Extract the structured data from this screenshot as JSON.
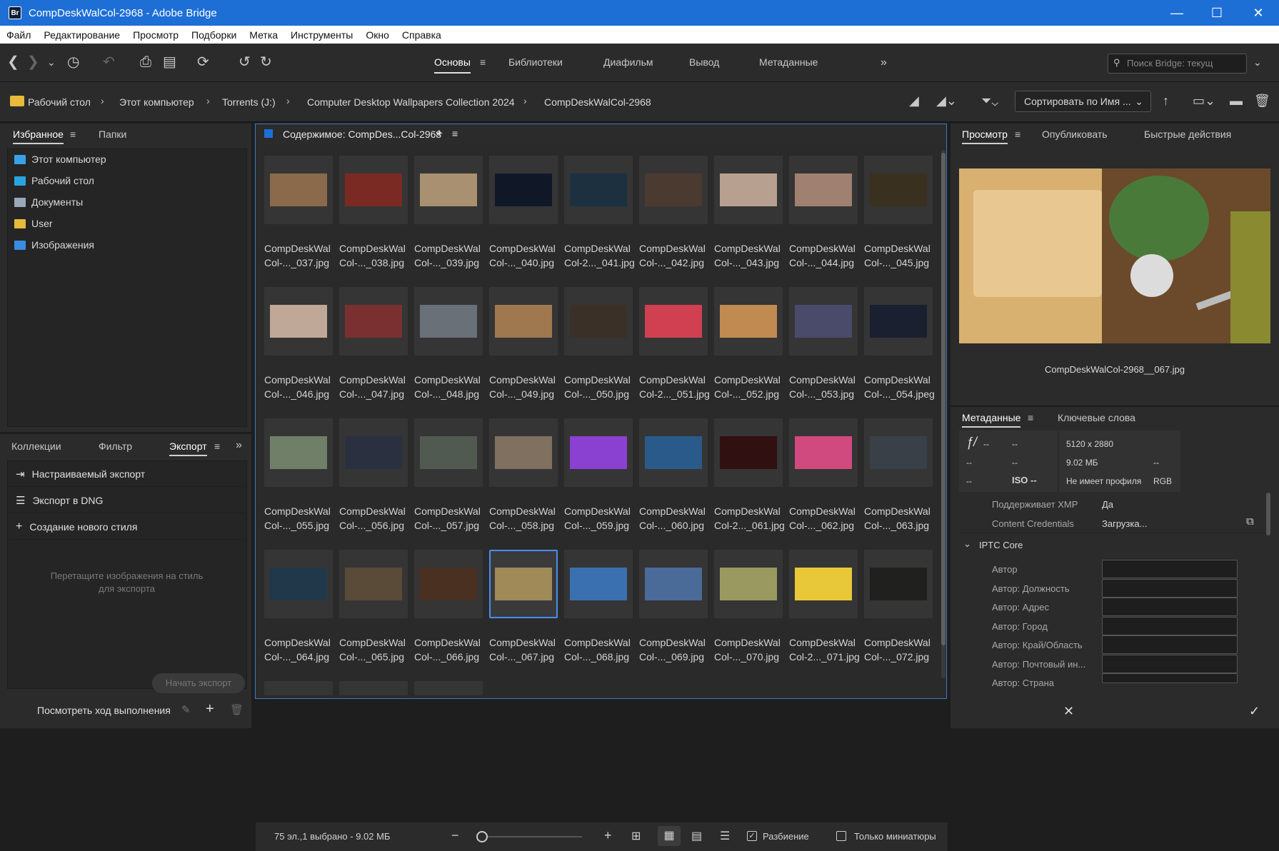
{
  "window": {
    "logo": "Br",
    "title": "CompDeskWalCol-2968 - Adobe Bridge",
    "minimize_icon": "—",
    "maximize_icon": "☐",
    "close_icon": "✕"
  },
  "menu": [
    "Файл",
    "Редактирование",
    "Просмотр",
    "Подборки",
    "Метка",
    "Инструменты",
    "Окно",
    "Справка"
  ],
  "workspaces": [
    "Основы",
    "Библиотеки",
    "Диафильм",
    "Вывод",
    "Метаданные"
  ],
  "search": {
    "placeholder": "Поиск Bridge: текущ"
  },
  "breadcrumbs": [
    "Рабочий стол",
    "Этот компьютер",
    "Torrents (J:)",
    "Computer Desktop Wallpapers Collection 2024",
    "CompDeskWalCol-2968"
  ],
  "sort": {
    "label": "Сортировать по Имя ..."
  },
  "left_panel": {
    "tabs": [
      "Избранное",
      "Папки"
    ],
    "favorites": [
      {
        "label": "Этот компьютер",
        "color": "#3aa0e8"
      },
      {
        "label": "Рабочий стол",
        "color": "#29a3e0"
      },
      {
        "label": "Документы",
        "color": "#9aa8b8"
      },
      {
        "label": "User",
        "color": "#e8b93a"
      },
      {
        "label": "Изображения",
        "color": "#3a8ce0"
      }
    ]
  },
  "bottom_left": {
    "tabs": [
      "Коллекции",
      "Фильтр",
      "Экспорт"
    ],
    "export_items": [
      "Настраиваемый экспорт",
      "Экспорт в DNG",
      "Создание нового стиля"
    ],
    "drop_hint": "Перетащите изображения на стиль для экспорта",
    "start_export": "Начать экспорт",
    "view_progress": "Посмотреть ход выполнения"
  },
  "content": {
    "header": "Содержимое: CompDes...Col-2968",
    "status": "75 эл.,1 выбрано - 9.02 МБ",
    "split_label": "Разбиение",
    "thumbs_only_label": "Только миниатюры",
    "items": [
      {
        "l1": "CompDeskWal",
        "l2": "Col-..._037.jpg",
        "c": "#8a6a4a"
      },
      {
        "l1": "CompDeskWal",
        "l2": "Col-..._038.jpg",
        "c": "#7a2a22"
      },
      {
        "l1": "CompDeskWal",
        "l2": "Col-..._039.jpg",
        "c": "#a89070"
      },
      {
        "l1": "CompDeskWal",
        "l2": "Col-..._040.jpg",
        "c": "#101828"
      },
      {
        "l1": "CompDeskWal",
        "l2": "Col-2..._041.jpg",
        "c": "#1d3040"
      },
      {
        "l1": "CompDeskWal",
        "l2": "Col-..._042.jpg",
        "c": "#4a3a30"
      },
      {
        "l1": "CompDeskWal",
        "l2": "Col-..._043.jpg",
        "c": "#b8a090"
      },
      {
        "l1": "CompDeskWal",
        "l2": "Col-..._044.jpg",
        "c": "#a08070"
      },
      {
        "l1": "CompDeskWal",
        "l2": "Col-..._045.jpg",
        "c": "#3a3020"
      },
      {
        "l1": "CompDeskWal",
        "l2": "Col-..._046.jpg",
        "c": "#c0a898"
      },
      {
        "l1": "CompDeskWal",
        "l2": "Col-..._047.jpg",
        "c": "#7a3030"
      },
      {
        "l1": "CompDeskWal",
        "l2": "Col-..._048.jpg",
        "c": "#6a7078"
      },
      {
        "l1": "CompDeskWal",
        "l2": "Col-..._049.jpg",
        "c": "#a07850"
      },
      {
        "l1": "CompDeskWal",
        "l2": "Col-..._050.jpg",
        "c": "#3a3028"
      },
      {
        "l1": "CompDeskWal",
        "l2": "Col-2..._051.jpg",
        "c": "#d04050"
      },
      {
        "l1": "CompDeskWal",
        "l2": "Col-..._052.jpg",
        "c": "#c08a50"
      },
      {
        "l1": "CompDeskWal",
        "l2": "Col-..._053.jpg",
        "c": "#4a4a6a"
      },
      {
        "l1": "CompDeskWal",
        "l2": "Col-..._054.jpeg",
        "c": "#1a2030"
      },
      {
        "l1": "CompDeskWal",
        "l2": "Col-..._055.jpg",
        "c": "#708068"
      },
      {
        "l1": "CompDeskWal",
        "l2": "Col-..._056.jpg",
        "c": "#2a3040"
      },
      {
        "l1": "CompDeskWal",
        "l2": "Col-..._057.jpg",
        "c": "#505a50"
      },
      {
        "l1": "CompDeskWal",
        "l2": "Col-..._058.jpg",
        "c": "#807060"
      },
      {
        "l1": "CompDeskWal",
        "l2": "Col-..._059.jpg",
        "c": "#8a40d0"
      },
      {
        "l1": "CompDeskWal",
        "l2": "Col-..._060.jpg",
        "c": "#2a5a8a"
      },
      {
        "l1": "CompDeskWal",
        "l2": "Col-2..._061.jpg",
        "c": "#301010"
      },
      {
        "l1": "CompDeskWal",
        "l2": "Col-..._062.jpg",
        "c": "#d04a80"
      },
      {
        "l1": "CompDeskWal",
        "l2": "Col-..._063.jpg",
        "c": "#3a4048"
      },
      {
        "l1": "CompDeskWal",
        "l2": "Col-..._064.jpg",
        "c": "#20384a"
      },
      {
        "l1": "CompDeskWal",
        "l2": "Col-..._065.jpg",
        "c": "#5a4a38"
      },
      {
        "l1": "CompDeskWal",
        "l2": "Col-..._066.jpg",
        "c": "#4a3020"
      },
      {
        "l1": "CompDeskWal",
        "l2": "Col-..._067.jpg",
        "c": "#a08a58",
        "selected": true
      },
      {
        "l1": "CompDeskWal",
        "l2": "Col-..._068.jpg",
        "c": "#3a70b0"
      },
      {
        "l1": "CompDeskWal",
        "l2": "Col-..._069.jpg",
        "c": "#4a6a98"
      },
      {
        "l1": "CompDeskWal",
        "l2": "Col-..._070.jpg",
        "c": "#9a9a60"
      },
      {
        "l1": "CompDeskWal",
        "l2": "Col-2..._071.jpg",
        "c": "#e8c838"
      },
      {
        "l1": "CompDeskWal",
        "l2": "Col-..._072.jpg",
        "c": "#20201e"
      }
    ]
  },
  "right_panel": {
    "top_tabs": [
      "Просмотр",
      "Опубликовать",
      "Быстрые действия"
    ],
    "preview_caption": "CompDeskWalCol-2968__067.jpg",
    "meta_tabs": [
      "Метаданные",
      "Ключевые слова"
    ],
    "camera": {
      "f_icon": "ƒ/",
      "f_val": "--",
      "shutter": "--",
      "c1": "--",
      "c2": "--",
      "c3": "--",
      "iso": "ISO --",
      "dims": "5120 x 2880",
      "size": "9.02 МБ",
      "size_dash": "--",
      "profile": "Не имеет профиля",
      "mode": "RGB"
    },
    "xmp_label": "Поддерживает XMP",
    "xmp_val": "Да",
    "cc_label": "Content Credentials",
    "cc_val": "Загрузка...",
    "iptc_header": "IPTC Core",
    "iptc_fields": [
      "Автор",
      "Автор: Должность",
      "Автор: Адрес",
      "Автор: Город",
      "Автор: Край/Область",
      "Автор: Почтовый ин...",
      "Автор: Страна"
    ]
  },
  "accent": "#1d6fd6",
  "selection_color": "#4a8df0"
}
